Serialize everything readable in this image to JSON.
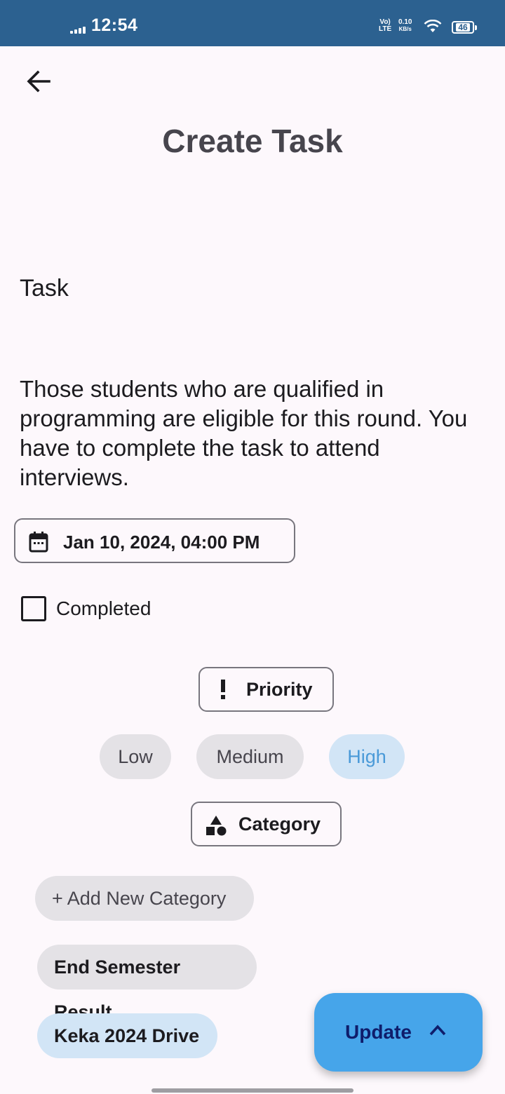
{
  "status_bar": {
    "time": "12:54",
    "network_top": "Vo)",
    "network_bottom": "LTE",
    "speed_value": "0.10",
    "speed_unit": "KB/s",
    "battery": "46"
  },
  "header": {
    "back_icon": "arrow-back-icon",
    "title": "Create Task"
  },
  "form": {
    "task_title": "Task",
    "task_description": "Those students who are qualified in programming are eligible for this round. You have to complete the task to attend interviews.",
    "due_date": {
      "icon": "calendar-icon",
      "label": "Jan 10, 2024, 04:00 PM"
    },
    "completed": {
      "label": "Completed",
      "checked": false
    },
    "priority": {
      "icon": "exclamation-icon",
      "label": "Priority",
      "options": [
        "Low",
        "Medium",
        "High"
      ],
      "selected": "High"
    },
    "category": {
      "icon": "shapes-icon",
      "label": "Category",
      "add_label": "+ Add New Category",
      "items": [
        "End Semester Result",
        "Keka 2024 Drive"
      ],
      "selected": "Keka 2024 Drive"
    }
  },
  "fab": {
    "label": "Update",
    "icon": "chevron-up-icon"
  },
  "colors": {
    "status_bar": "#2c6190",
    "background": "#fdf8fc",
    "chip": "#e4e2e6",
    "chip_selected": "#d2e5f6",
    "chip_selected_text": "#4a9ad8",
    "fab": "#46a5ea"
  }
}
